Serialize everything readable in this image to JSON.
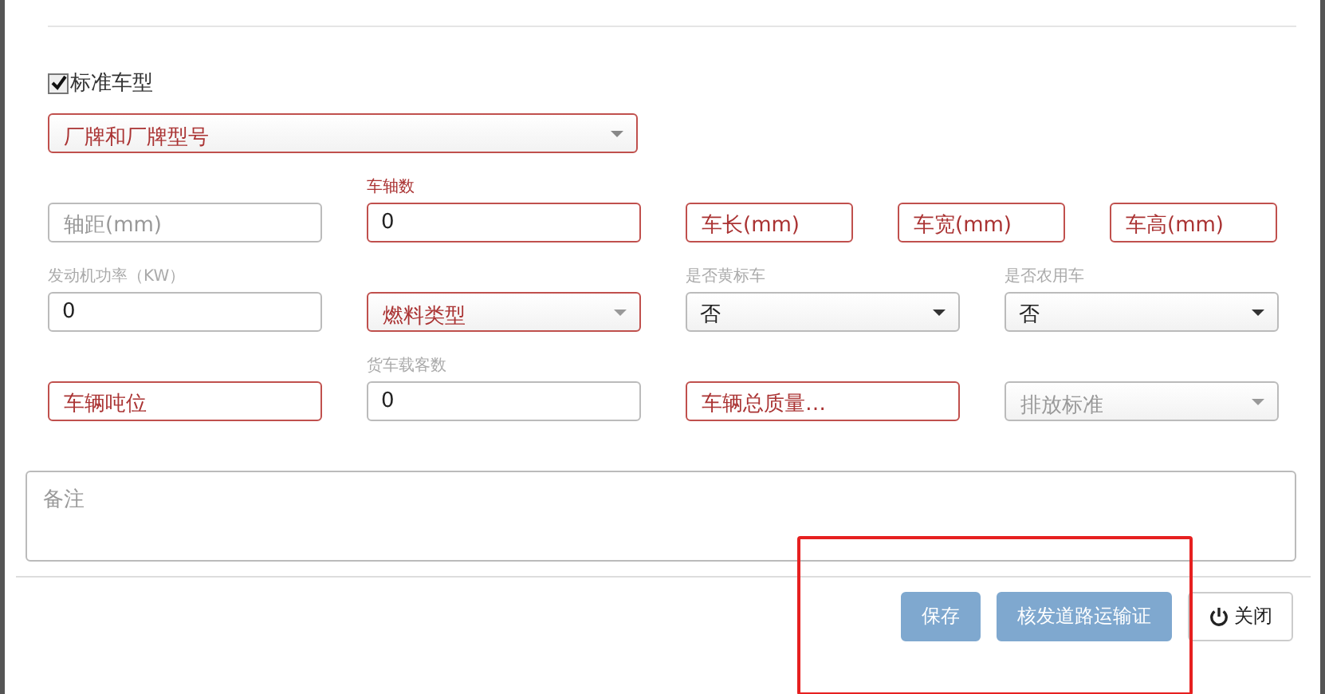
{
  "standard_model": {
    "label": "标准车型",
    "checked": true
  },
  "brand": {
    "placeholder": "厂牌和厂牌型号",
    "required": true
  },
  "rows": [
    [
      {
        "kind": "input",
        "placeholder": "轴距(mm)",
        "required": false
      },
      {
        "kind": "input",
        "label": "车轴数",
        "value": "0",
        "required": true
      },
      {
        "kind": "input",
        "placeholder": "车长(mm)",
        "required": true
      },
      {
        "kind": "input",
        "placeholder": "车宽(mm)",
        "required": true
      },
      {
        "kind": "input",
        "placeholder": "车高(mm)",
        "required": true
      }
    ],
    [
      {
        "kind": "input",
        "label": "发动机功率（KW）",
        "value": "0",
        "required": false
      },
      {
        "kind": "select",
        "placeholder": "燃料类型",
        "required": true
      },
      {
        "kind": "select",
        "label": "是否黄标车",
        "value": "否",
        "required": false
      },
      {
        "kind": "select",
        "label": "是否农用车",
        "value": "否",
        "required": false
      }
    ],
    [
      {
        "kind": "input",
        "placeholder": "车辆吨位",
        "required": true
      },
      {
        "kind": "input",
        "label": "货车载客数",
        "value": "0",
        "required": false
      },
      {
        "kind": "input",
        "placeholder": "车辆总质量…",
        "required": true
      },
      {
        "kind": "select",
        "placeholder": "排放标准",
        "required": false
      }
    ]
  ],
  "remarks": {
    "placeholder": "备注"
  },
  "buttons": [
    {
      "label": "保存",
      "kind": "primary"
    },
    {
      "label": "核发道路运输证",
      "kind": "primary"
    },
    {
      "label": "关闭",
      "kind": "close"
    }
  ]
}
